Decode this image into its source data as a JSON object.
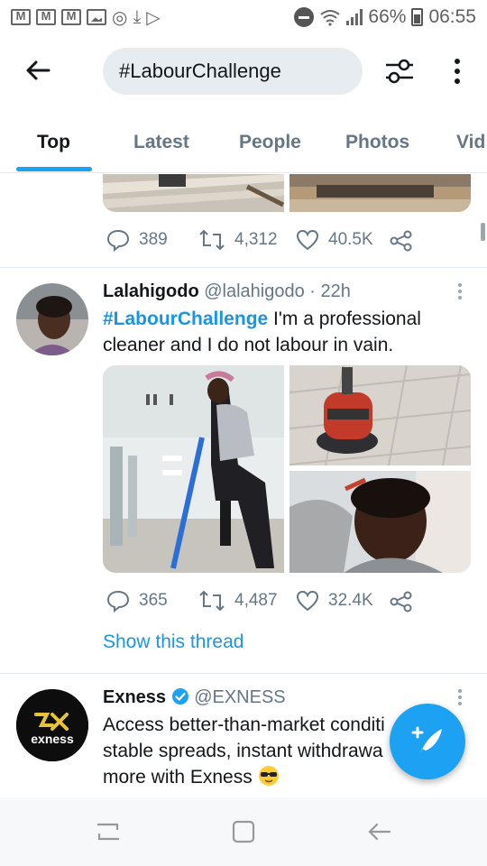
{
  "status_bar": {
    "battery": "66%",
    "time": "06:55"
  },
  "search": {
    "query": "#LabourChallenge"
  },
  "tabs": [
    "Top",
    "Latest",
    "People",
    "Photos",
    "Vid"
  ],
  "active_tab": "Top",
  "previous_tweet": {
    "replies": "389",
    "retweets": "4,312",
    "likes": "40.5K"
  },
  "tweet": {
    "name": "Lalahigodo",
    "handle": "@lalahigodo",
    "time_sep": " · ",
    "time": "22h",
    "hashtag": "#LabourChallenge",
    "text_line1": " I'm a professional",
    "text_line2": "cleaner and I do not labour in vain.",
    "replies": "365",
    "retweets": "4,487",
    "likes": "32.4K",
    "show_thread": "Show this thread"
  },
  "promoted": {
    "name": "Exness",
    "handle": "@EXNESS",
    "avatar_text": "exness",
    "text_line1": "Access better-than-market conditi",
    "text_line2": "stable spreads, instant withdrawa",
    "text_line3": "more with Exness"
  },
  "colors": {
    "accent": "#1da1f2",
    "link": "#1b95e0",
    "muted": "#657786"
  }
}
